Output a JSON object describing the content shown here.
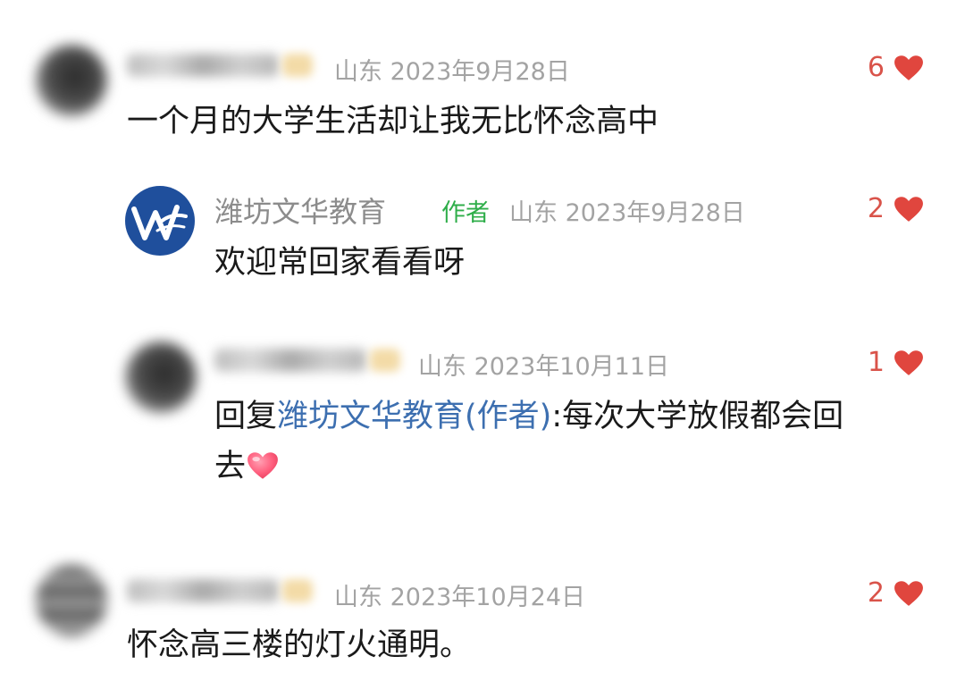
{
  "colors": {
    "text": "#1a1a1a",
    "meta": "#a3a3a3",
    "author_name": "#8c8c8c",
    "author_tag": "#2fae4a",
    "reply_link": "#3d6fb0",
    "like": "#d9534a",
    "logo_bg": "#1f4f9c"
  },
  "comments": [
    {
      "location": "山东",
      "date": "2023年9月28日",
      "text": "一个月的大学生活却让我无比怀念高中",
      "likes": "6",
      "avatar_icon": "avatar-icon"
    },
    {
      "author_name": "潍坊文华教育",
      "author_tag": "作者",
      "location": "山东",
      "date": "2023年9月28日",
      "text": "欢迎常回家看看呀",
      "likes": "2",
      "avatar_icon": "logo-icon"
    },
    {
      "location": "山东",
      "date": "2023年10月11日",
      "reply_prefix": "回复",
      "reply_target": "潍坊文华教育(作者)",
      "reply_sep": ":",
      "text_line1": "每次大学放假都会回",
      "text_line2": "去",
      "likes": "1",
      "emoji_icon": "heart-emoji-icon"
    },
    {
      "location": "山东",
      "date": "2023年10月24日",
      "text": "怀念高三楼的灯火通明。",
      "likes": "2",
      "avatar_icon": "avatar-icon"
    }
  ]
}
